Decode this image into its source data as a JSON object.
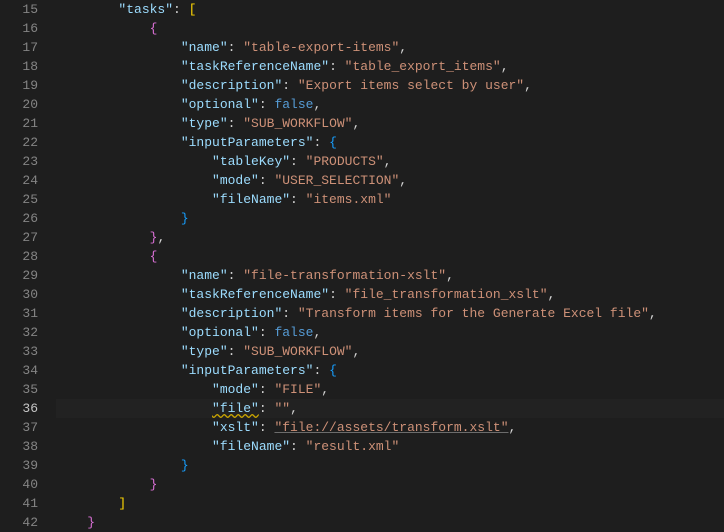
{
  "filetype": "json",
  "first_line": 15,
  "active_line": 36,
  "lines": [
    {
      "indent": 2,
      "tokens": [
        {
          "t": "key",
          "v": "\"tasks\""
        },
        {
          "t": "punct",
          "v": ": "
        },
        {
          "t": "brace",
          "v": "["
        }
      ]
    },
    {
      "indent": 3,
      "tokens": [
        {
          "t": "brace2",
          "v": "{"
        }
      ]
    },
    {
      "indent": 4,
      "tokens": [
        {
          "t": "key",
          "v": "\"name\""
        },
        {
          "t": "punct",
          "v": ": "
        },
        {
          "t": "str",
          "v": "\"table-export-items\""
        },
        {
          "t": "punct",
          "v": ","
        }
      ]
    },
    {
      "indent": 4,
      "tokens": [
        {
          "t": "key",
          "v": "\"taskReferenceName\""
        },
        {
          "t": "punct",
          "v": ": "
        },
        {
          "t": "str",
          "v": "\"table_export_items\""
        },
        {
          "t": "punct",
          "v": ","
        }
      ]
    },
    {
      "indent": 4,
      "tokens": [
        {
          "t": "key",
          "v": "\"description\""
        },
        {
          "t": "punct",
          "v": ": "
        },
        {
          "t": "str",
          "v": "\"Export items select by user\""
        },
        {
          "t": "punct",
          "v": ","
        }
      ]
    },
    {
      "indent": 4,
      "tokens": [
        {
          "t": "key",
          "v": "\"optional\""
        },
        {
          "t": "punct",
          "v": ": "
        },
        {
          "t": "bool",
          "v": "false"
        },
        {
          "t": "punct",
          "v": ","
        }
      ]
    },
    {
      "indent": 4,
      "tokens": [
        {
          "t": "key",
          "v": "\"type\""
        },
        {
          "t": "punct",
          "v": ": "
        },
        {
          "t": "str",
          "v": "\"SUB_WORKFLOW\""
        },
        {
          "t": "punct",
          "v": ","
        }
      ]
    },
    {
      "indent": 4,
      "tokens": [
        {
          "t": "key",
          "v": "\"inputParameters\""
        },
        {
          "t": "punct",
          "v": ": "
        },
        {
          "t": "brace3",
          "v": "{"
        }
      ]
    },
    {
      "indent": 5,
      "tokens": [
        {
          "t": "key",
          "v": "\"tableKey\""
        },
        {
          "t": "punct",
          "v": ": "
        },
        {
          "t": "str",
          "v": "\"PRODUCTS\""
        },
        {
          "t": "punct",
          "v": ","
        }
      ]
    },
    {
      "indent": 5,
      "tokens": [
        {
          "t": "key",
          "v": "\"mode\""
        },
        {
          "t": "punct",
          "v": ": "
        },
        {
          "t": "str",
          "v": "\"USER_SELECTION\""
        },
        {
          "t": "punct",
          "v": ","
        }
      ]
    },
    {
      "indent": 5,
      "tokens": [
        {
          "t": "key",
          "v": "\"fileName\""
        },
        {
          "t": "punct",
          "v": ": "
        },
        {
          "t": "str",
          "v": "\"items.xml\""
        }
      ]
    },
    {
      "indent": 4,
      "tokens": [
        {
          "t": "brace3",
          "v": "}"
        }
      ]
    },
    {
      "indent": 3,
      "tokens": [
        {
          "t": "brace2",
          "v": "}"
        },
        {
          "t": "punct",
          "v": ","
        }
      ]
    },
    {
      "indent": 3,
      "tokens": [
        {
          "t": "brace2",
          "v": "{"
        }
      ]
    },
    {
      "indent": 4,
      "tokens": [
        {
          "t": "key",
          "v": "\"name\""
        },
        {
          "t": "punct",
          "v": ": "
        },
        {
          "t": "str",
          "v": "\"file-transformation-xslt\""
        },
        {
          "t": "punct",
          "v": ","
        }
      ]
    },
    {
      "indent": 4,
      "tokens": [
        {
          "t": "key",
          "v": "\"taskReferenceName\""
        },
        {
          "t": "punct",
          "v": ": "
        },
        {
          "t": "str",
          "v": "\"file_transformation_xslt\""
        },
        {
          "t": "punct",
          "v": ","
        }
      ]
    },
    {
      "indent": 4,
      "tokens": [
        {
          "t": "key",
          "v": "\"description\""
        },
        {
          "t": "punct",
          "v": ": "
        },
        {
          "t": "str",
          "v": "\"Transform items for the Generate Excel file\""
        },
        {
          "t": "punct",
          "v": ","
        }
      ]
    },
    {
      "indent": 4,
      "tokens": [
        {
          "t": "key",
          "v": "\"optional\""
        },
        {
          "t": "punct",
          "v": ": "
        },
        {
          "t": "bool",
          "v": "false"
        },
        {
          "t": "punct",
          "v": ","
        }
      ]
    },
    {
      "indent": 4,
      "tokens": [
        {
          "t": "key",
          "v": "\"type\""
        },
        {
          "t": "punct",
          "v": ": "
        },
        {
          "t": "str",
          "v": "\"SUB_WORKFLOW\""
        },
        {
          "t": "punct",
          "v": ","
        }
      ]
    },
    {
      "indent": 4,
      "tokens": [
        {
          "t": "key",
          "v": "\"inputParameters\""
        },
        {
          "t": "punct",
          "v": ": "
        },
        {
          "t": "brace3",
          "v": "{"
        }
      ]
    },
    {
      "indent": 5,
      "tokens": [
        {
          "t": "key",
          "v": "\"mode\""
        },
        {
          "t": "punct",
          "v": ": "
        },
        {
          "t": "str",
          "v": "\"FILE\""
        },
        {
          "t": "punct",
          "v": ","
        }
      ]
    },
    {
      "indent": 5,
      "tokens": [
        {
          "t": "key",
          "v": "\"file\"",
          "warn": true
        },
        {
          "t": "punct",
          "v": ": "
        },
        {
          "t": "str",
          "v": "\"\""
        },
        {
          "t": "punct",
          "v": ","
        }
      ]
    },
    {
      "indent": 5,
      "tokens": [
        {
          "t": "key",
          "v": "\"xslt\""
        },
        {
          "t": "punct",
          "v": ": "
        },
        {
          "t": "str",
          "v": "\"file://assets/transform.xslt\"",
          "ul": true
        },
        {
          "t": "punct",
          "v": ","
        }
      ]
    },
    {
      "indent": 5,
      "tokens": [
        {
          "t": "key",
          "v": "\"fileName\""
        },
        {
          "t": "punct",
          "v": ": "
        },
        {
          "t": "str",
          "v": "\"result.xml\""
        }
      ]
    },
    {
      "indent": 4,
      "tokens": [
        {
          "t": "brace3",
          "v": "}"
        }
      ]
    },
    {
      "indent": 3,
      "tokens": [
        {
          "t": "brace2",
          "v": "}"
        }
      ]
    },
    {
      "indent": 2,
      "tokens": [
        {
          "t": "brace",
          "v": "]"
        }
      ]
    },
    {
      "indent": 1,
      "tokens": [
        {
          "t": "brace2",
          "v": "}"
        }
      ]
    }
  ]
}
